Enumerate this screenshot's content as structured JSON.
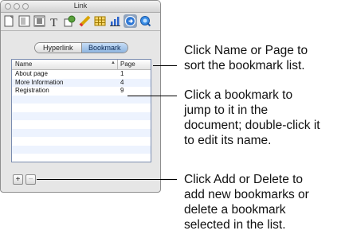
{
  "window": {
    "title": "Link"
  },
  "toolbar": {
    "icons": [
      "document-icon",
      "layout-icon",
      "wrap-icon",
      "text-icon",
      "graphic-icon",
      "metrics-icon",
      "table-icon",
      "chart-icon",
      "link-icon",
      "quicktime-icon"
    ],
    "selected": "link-icon"
  },
  "tabs": {
    "hyperlink": "Hyperlink",
    "bookmark": "Bookmark",
    "active": "Bookmark"
  },
  "bookmarks": {
    "columns": {
      "name": "Name",
      "page": "Page"
    },
    "rows": [
      {
        "name": "About page",
        "page": "1"
      },
      {
        "name": "More Information",
        "page": "4"
      },
      {
        "name": "Registration",
        "page": "9"
      }
    ]
  },
  "buttons": {
    "add": "+",
    "delete": "−"
  },
  "captions": {
    "sort": [
      "Click Name or Page to",
      "sort the bookmark list."
    ],
    "jump": [
      "Click a bookmark to",
      "jump to it in the",
      "document; double-click it",
      "to edit its name."
    ],
    "add_delete": [
      "Click Add or Delete to",
      "add new bookmarks or",
      "delete a bookmark",
      "selected in the list."
    ]
  }
}
